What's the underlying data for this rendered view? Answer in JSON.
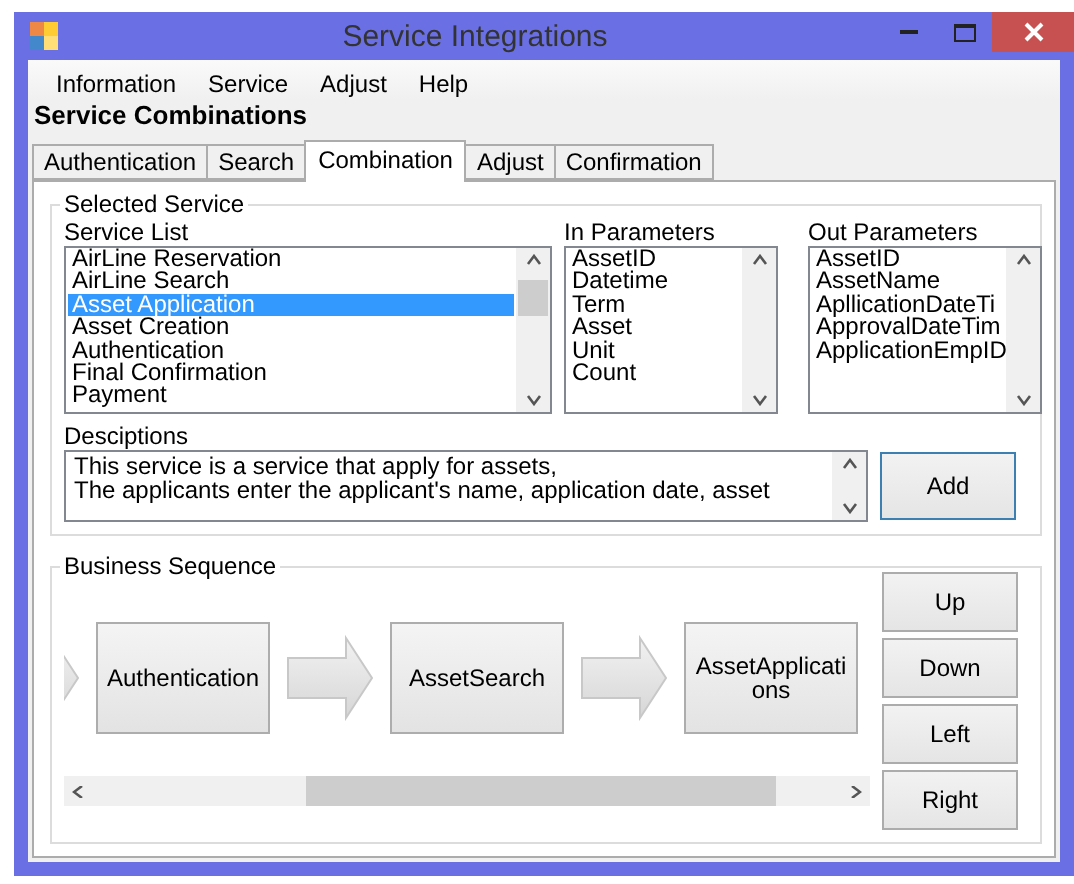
{
  "window": {
    "title": "Service Integrations"
  },
  "menu": [
    "Information",
    "Service",
    "Adjust",
    "Help"
  ],
  "heading": "Service Combinations",
  "tabs": [
    {
      "label": "Authentication",
      "selected": false
    },
    {
      "label": "Search",
      "selected": false
    },
    {
      "label": "Combination",
      "selected": true
    },
    {
      "label": "Adjust",
      "selected": false
    },
    {
      "label": "Confirmation",
      "selected": false
    }
  ],
  "selected_service": {
    "title": "Selected Service",
    "service_list": {
      "label": "Service List",
      "items": [
        {
          "label": "AirLine Reservation",
          "selected": false
        },
        {
          "label": "AirLine Search",
          "selected": false
        },
        {
          "label": "Asset Application",
          "selected": true
        },
        {
          "label": "Asset Creation",
          "selected": false
        },
        {
          "label": "Authentication",
          "selected": false
        },
        {
          "label": "Final Confirmation",
          "selected": false
        },
        {
          "label": "Payment",
          "selected": false
        }
      ]
    },
    "in_parameters": {
      "label": "In Parameters",
      "items": [
        "AssetID",
        "Datetime",
        "Term",
        "Asset",
        "Unit",
        "Count"
      ]
    },
    "out_parameters": {
      "label": "Out Parameters",
      "items": [
        "AssetID",
        "AssetName",
        "ApllicationDateTi",
        "ApprovalDateTim",
        "ApplicationEmpID"
      ]
    },
    "descriptions": {
      "label": "Desciptions",
      "lines": [
        "This service is a service that apply for assets,",
        "The applicants enter the applicant's name, application date, asset"
      ]
    },
    "add_button": "Add"
  },
  "business_sequence": {
    "title": "Business Sequence",
    "steps": [
      "Authentication",
      "AssetSearch",
      "AssetApplications"
    ],
    "buttons": [
      "Up",
      "Down",
      "Left",
      "Right"
    ]
  }
}
